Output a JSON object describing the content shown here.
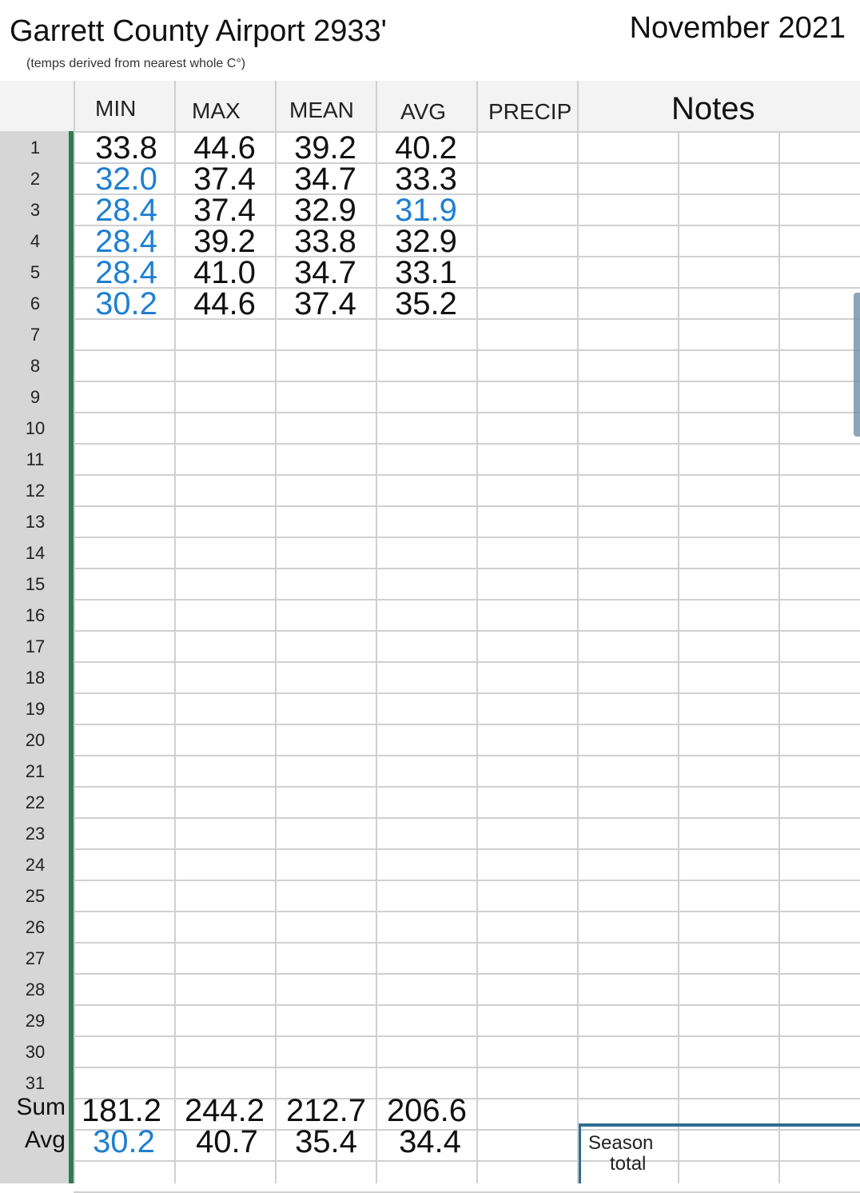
{
  "header": {
    "title": "Garrett County Airport 2933'",
    "subtitle": "(temps derived from nearest whole C°)",
    "month": "November 2021"
  },
  "columns": [
    "MIN",
    "MAX",
    "MEAN",
    "AVG",
    "PRECIP",
    "Notes"
  ],
  "row_numbers": [
    "1",
    "2",
    "3",
    "4",
    "5",
    "6",
    "7",
    "8",
    "9",
    "10",
    "11",
    "12",
    "13",
    "14",
    "15",
    "16",
    "17",
    "18",
    "19",
    "20",
    "21",
    "22",
    "23",
    "24",
    "25",
    "26",
    "27",
    "28",
    "29",
    "30",
    "31"
  ],
  "rows": [
    {
      "min": "33.8",
      "max": "44.6",
      "mean": "39.2",
      "avg": "40.2",
      "min_blue": false,
      "avg_blue": false
    },
    {
      "min": "32.0",
      "max": "37.4",
      "mean": "34.7",
      "avg": "33.3",
      "min_blue": true,
      "avg_blue": false
    },
    {
      "min": "28.4",
      "max": "37.4",
      "mean": "32.9",
      "avg": "31.9",
      "min_blue": true,
      "avg_blue": true
    },
    {
      "min": "28.4",
      "max": "39.2",
      "mean": "33.8",
      "avg": "32.9",
      "min_blue": true,
      "avg_blue": false
    },
    {
      "min": "28.4",
      "max": "41.0",
      "mean": "34.7",
      "avg": "33.1",
      "min_blue": true,
      "avg_blue": false
    },
    {
      "min": "30.2",
      "max": "44.6",
      "mean": "37.4",
      "avg": "35.2",
      "min_blue": true,
      "avg_blue": false
    }
  ],
  "summary": {
    "sum_label": "Sum",
    "sum": {
      "min": "181.2",
      "max": "244.2",
      "mean": "212.7",
      "avg": "206.6"
    },
    "avg_label": "Avg",
    "avg": {
      "min": "30.2",
      "max": "40.7",
      "mean": "35.4",
      "avg": "34.4"
    }
  },
  "season_total_label": "Season\ntotal",
  "colors": {
    "blue": "#1f7fd1",
    "row_header": "#d6d6d6",
    "green_bar": "#2f7d4f",
    "grid": "#d0d0d0",
    "season_border": "#2e6f8e"
  }
}
